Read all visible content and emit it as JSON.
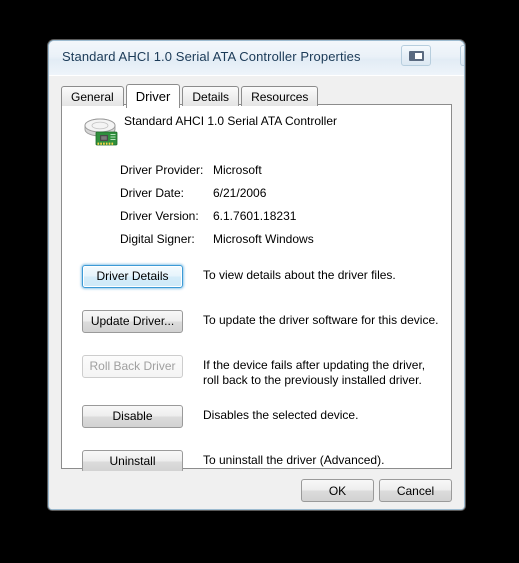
{
  "window": {
    "title": "Standard AHCI 1.0 Serial ATA Controller Properties",
    "restore_icon": "restore-window-icon",
    "close_icon": "close-icon",
    "accent_color": "#3c9ad6",
    "titlebar_color": "#eaf1f8",
    "body_color": "#f0f0f0"
  },
  "tabs": [
    {
      "label": "General",
      "active": false
    },
    {
      "label": "Driver",
      "active": true
    },
    {
      "label": "Details",
      "active": false
    },
    {
      "label": "Resources",
      "active": false
    }
  ],
  "device": {
    "icon": "disk-controller-icon",
    "name": "Standard AHCI 1.0 Serial ATA Controller"
  },
  "driver_info": [
    {
      "label": "Driver Provider:",
      "value": "Microsoft"
    },
    {
      "label": "Driver Date:",
      "value": "6/21/2006"
    },
    {
      "label": "Driver Version:",
      "value": "6.1.7601.18231"
    },
    {
      "label": "Digital Signer:",
      "value": "Microsoft Windows"
    }
  ],
  "actions": [
    {
      "label": "Driver Details",
      "description": "To view details about the driver files.",
      "state": "focused"
    },
    {
      "label": "Update Driver...",
      "description": "To update the driver software for this device.",
      "state": "normal"
    },
    {
      "label": "Roll Back Driver",
      "description": "If the device fails after updating the driver, roll back to the previously installed driver.",
      "state": "disabled"
    },
    {
      "label": "Disable",
      "description": "Disables the selected device.",
      "state": "normal"
    },
    {
      "label": "Uninstall",
      "description": "To uninstall the driver (Advanced).",
      "state": "normal"
    }
  ],
  "footer": {
    "ok_label": "OK",
    "cancel_label": "Cancel"
  }
}
